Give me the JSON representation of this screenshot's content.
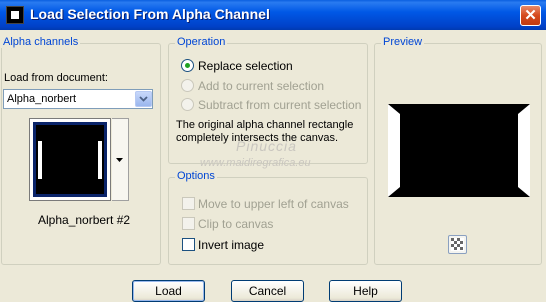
{
  "window": {
    "title": "Load Selection From Alpha Channel",
    "close_glyph": "✕",
    "icon": "paint-shop-icon"
  },
  "alpha_channels": {
    "legend": "Alpha channels",
    "load_from_label": "Load from document:",
    "document_value": "Alpha_norbert",
    "channel_name": "Alpha_norbert #2"
  },
  "operation": {
    "legend": "Operation",
    "options": [
      {
        "label": "Replace selection",
        "selected": true,
        "enabled": true
      },
      {
        "label": "Add to current selection",
        "selected": false,
        "enabled": false
      },
      {
        "label": "Subtract from current selection",
        "selected": false,
        "enabled": false
      }
    ],
    "info_line1": "The original alpha channel rectangle",
    "info_line2": "completely intersects the canvas."
  },
  "options": {
    "legend": "Options",
    "items": [
      {
        "label": "Move to upper left of canvas",
        "checked": false,
        "enabled": false
      },
      {
        "label": "Clip to canvas",
        "checked": false,
        "enabled": false
      },
      {
        "label": "Invert image",
        "checked": false,
        "enabled": true
      }
    ]
  },
  "preview": {
    "legend": "Preview",
    "zoom_icon": "checkerboard-icon"
  },
  "watermark": {
    "line1": "Pinuccia",
    "line2": "www.maidiregrafica.eu"
  },
  "buttons": {
    "load": "Load",
    "cancel": "Cancel",
    "help": "Help"
  },
  "colors": {
    "title_bar": "#0054e3",
    "legend_text": "#0046d5",
    "dialog_bg": "#ece9d8"
  }
}
